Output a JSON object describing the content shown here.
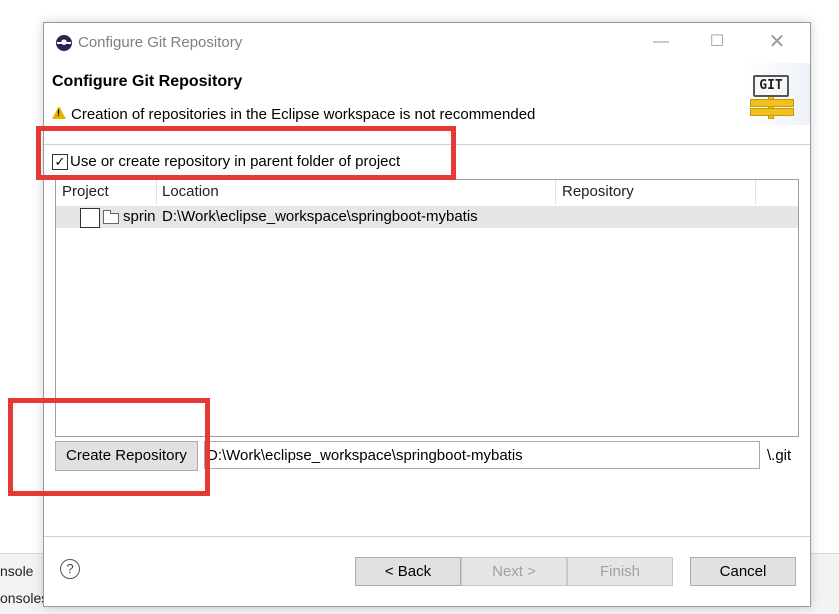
{
  "background": {
    "line1": "nsole",
    "line2": "onsoles"
  },
  "dialog": {
    "window_title": "Configure Git Repository",
    "header_title": "Configure Git Repository",
    "warning_message": "Creation of repositories in the Eclipse workspace is not recommended",
    "git_logo_text": "GIT",
    "window_controls": {
      "minimize": "—",
      "maximize": "☐",
      "close": "✕"
    }
  },
  "options": {
    "parent_folder_label": "Use or create repository in parent folder of project",
    "parent_folder_checked": true,
    "checkmark": "✓"
  },
  "table": {
    "columns": [
      "Project",
      "Location",
      "Repository"
    ],
    "rows": [
      {
        "project": "springboot-mybatis",
        "location": "D:\\Work\\eclipse_workspace\\springboot-mybatis",
        "repository": ""
      }
    ]
  },
  "create": {
    "button_label": "Create Repository",
    "path_value": "D:\\Work\\eclipse_workspace\\springboot-mybatis",
    "suffix": "\\.git"
  },
  "footer": {
    "help_glyph": "?",
    "back_label": "< Back",
    "next_label": "Next >",
    "finish_label": "Finish",
    "cancel_label": "Cancel"
  },
  "colors": {
    "annotation_red": "#e53935",
    "warning_yellow": "#e8b300",
    "row_highlight": "#e6e6e6"
  }
}
